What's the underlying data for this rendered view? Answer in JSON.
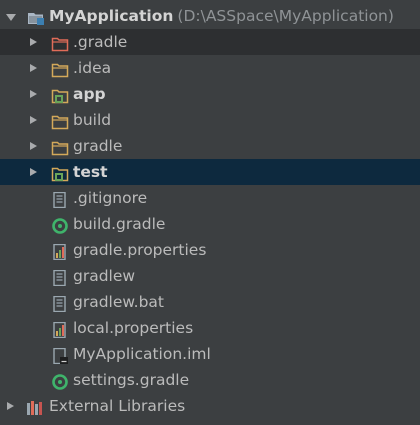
{
  "project": {
    "name": "MyApplication",
    "path": "(D:\\ASSpace\\MyApplication)"
  },
  "items": [
    {
      "label": ".gradle",
      "icon": "folder-excluded-icon"
    },
    {
      "label": ".idea",
      "icon": "folder-icon"
    },
    {
      "label": "app",
      "icon": "module-folder-icon"
    },
    {
      "label": "build",
      "icon": "folder-icon"
    },
    {
      "label": "gradle",
      "icon": "folder-icon"
    },
    {
      "label": "test",
      "icon": "module-folder-icon"
    },
    {
      "label": ".gitignore",
      "icon": "text-file-icon"
    },
    {
      "label": "build.gradle",
      "icon": "gradle-file-icon"
    },
    {
      "label": "gradle.properties",
      "icon": "properties-file-icon"
    },
    {
      "label": "gradlew",
      "icon": "text-file-icon"
    },
    {
      "label": "gradlew.bat",
      "icon": "text-file-icon"
    },
    {
      "label": "local.properties",
      "icon": "properties-file-icon"
    },
    {
      "label": "MyApplication.iml",
      "icon": "iml-file-icon"
    },
    {
      "label": "settings.gradle",
      "icon": "gradle-file-icon"
    }
  ],
  "external_libraries": {
    "label": "External Libraries",
    "icon": "libraries-icon"
  },
  "colors": {
    "background": "#3c3f41",
    "selection": "#0d293e",
    "folder": "#d4a95a",
    "excluded": "#e06c59",
    "module_marker": "#6aa55a",
    "gradle": "#3fb46b",
    "text": "#bbbbbb"
  }
}
